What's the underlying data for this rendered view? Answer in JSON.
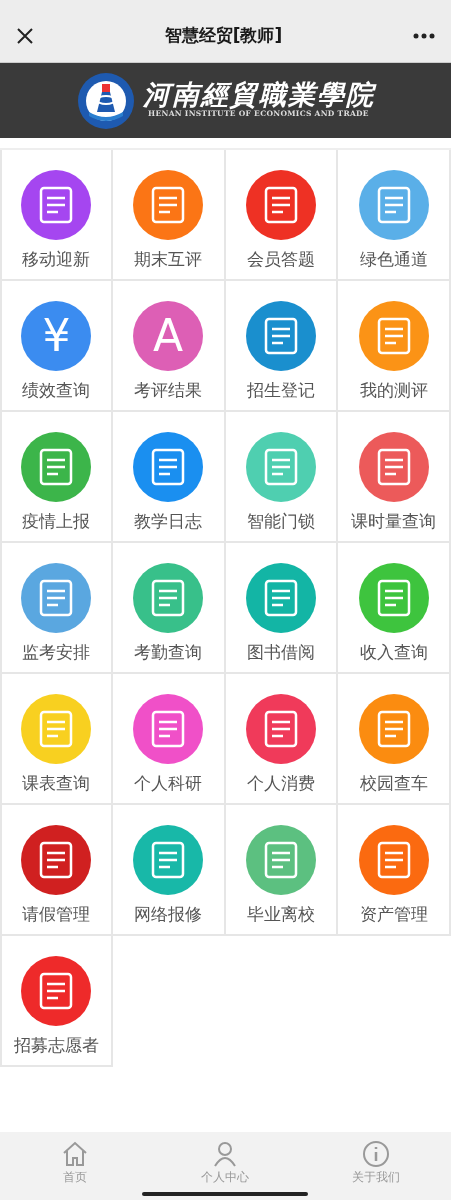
{
  "navbar": {
    "title": "智慧经贸[教师]"
  },
  "banner": {
    "school_name": "河南經貿職業學院",
    "english_name": "HENAN INSTITUTE OF ECONOMICS AND TRADE"
  },
  "apps": [
    {
      "label": "移动迎新",
      "color": "#a546f0"
    },
    {
      "label": "期末互评",
      "color": "#fb7515"
    },
    {
      "label": "会员答题",
      "color": "#ee3124"
    },
    {
      "label": "绿色通道",
      "color": "#5aafe8"
    },
    {
      "label": "绩效查询",
      "color": "#3b8cf0",
      "glyph": "¥"
    },
    {
      "label": "考评结果",
      "color": "#dd5fb5",
      "glyph": "A"
    },
    {
      "label": "招生登记",
      "color": "#1a8fce"
    },
    {
      "label": "我的测评",
      "color": "#fb9316"
    },
    {
      "label": "疫情上报",
      "color": "#3cb54a"
    },
    {
      "label": "教学日志",
      "color": "#1a8ff0"
    },
    {
      "label": "智能门锁",
      "color": "#4fcfb0"
    },
    {
      "label": "课时量查询",
      "color": "#ec5a5a"
    },
    {
      "label": "监考安排",
      "color": "#5aa7e0"
    },
    {
      "label": "考勤查询",
      "color": "#38c08a"
    },
    {
      "label": "图书借阅",
      "color": "#13b5a5"
    },
    {
      "label": "收入查询",
      "color": "#3ec43e"
    },
    {
      "label": "课表查询",
      "color": "#f8d020"
    },
    {
      "label": "个人科研",
      "color": "#f050c8"
    },
    {
      "label": "个人消费",
      "color": "#f03a5a"
    },
    {
      "label": "校园查车",
      "color": "#fb8c10"
    },
    {
      "label": "请假管理",
      "color": "#d02020"
    },
    {
      "label": "网络报修",
      "color": "#18b8a8"
    },
    {
      "label": "毕业离校",
      "color": "#5cc080"
    },
    {
      "label": "资产管理",
      "color": "#fb6a10"
    },
    {
      "label": "招募志愿者",
      "color": "#ee2a2a"
    }
  ],
  "tabbar": [
    {
      "label": "首页",
      "kind": "home"
    },
    {
      "label": "个人中心",
      "kind": "user"
    },
    {
      "label": "关于我们",
      "kind": "info"
    }
  ]
}
